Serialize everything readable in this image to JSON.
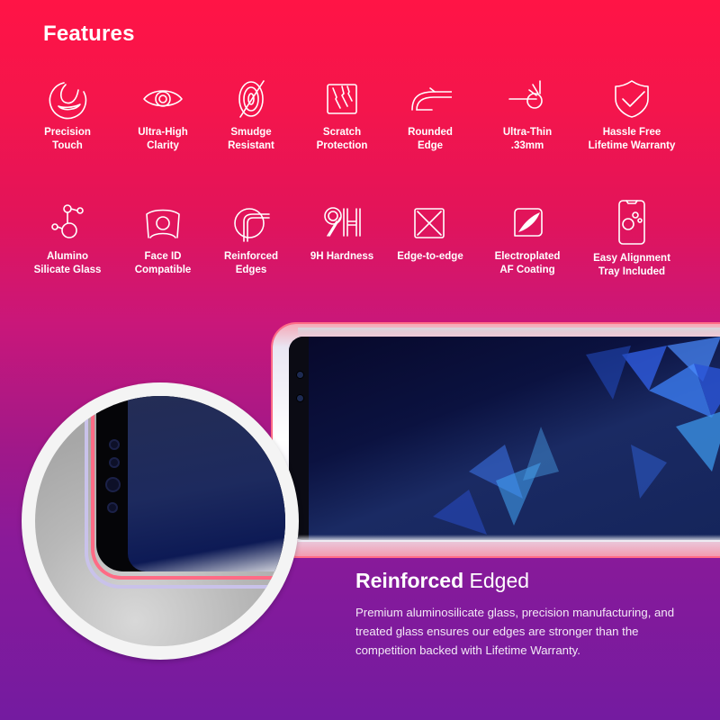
{
  "page": {
    "title": "Features",
    "background_colors": {
      "top": "#ff1446",
      "bottom": "#741ba0"
    }
  },
  "features": [
    {
      "icon": "precision-touch-icon",
      "label": "Precision\nTouch"
    },
    {
      "icon": "eye-icon",
      "label": "Ultra-High\nClarity"
    },
    {
      "icon": "fingerprint-slash-icon",
      "label": "Smudge\nResistant"
    },
    {
      "icon": "scratch-icon",
      "label": "Scratch\nProtection"
    },
    {
      "icon": "rounded-edge-icon",
      "label": "Rounded\nEdge"
    },
    {
      "icon": "ultra-thin-icon",
      "label": "Ultra-Thin\n.33mm"
    },
    {
      "icon": "shield-check-icon",
      "label": "Hassle Free\nLifetime Warranty"
    },
    {
      "icon": "molecule-icon",
      "label": "Alumino\nSilicate Glass"
    },
    {
      "icon": "face-id-icon",
      "label": "Face ID\nCompatible"
    },
    {
      "icon": "reinforced-edge-icon",
      "label": "Reinforced\nEdges"
    },
    {
      "icon": "9h-icon",
      "label": "9H Hardness"
    },
    {
      "icon": "edge-to-edge-icon",
      "label": "Edge-to-edge"
    },
    {
      "icon": "af-coating-icon",
      "label": "Electroplated\nAF Coating"
    },
    {
      "icon": "alignment-tray-icon",
      "label": "Easy Alignment\nTray Included"
    }
  ],
  "promo": {
    "headline_bold": "Reinforced",
    "headline_light": "Edged",
    "body": "Premium aluminosilicate glass, precision manufacturing, and treated glass ensures our edges are stronger than the competition backed with Lifetime Warranty."
  }
}
